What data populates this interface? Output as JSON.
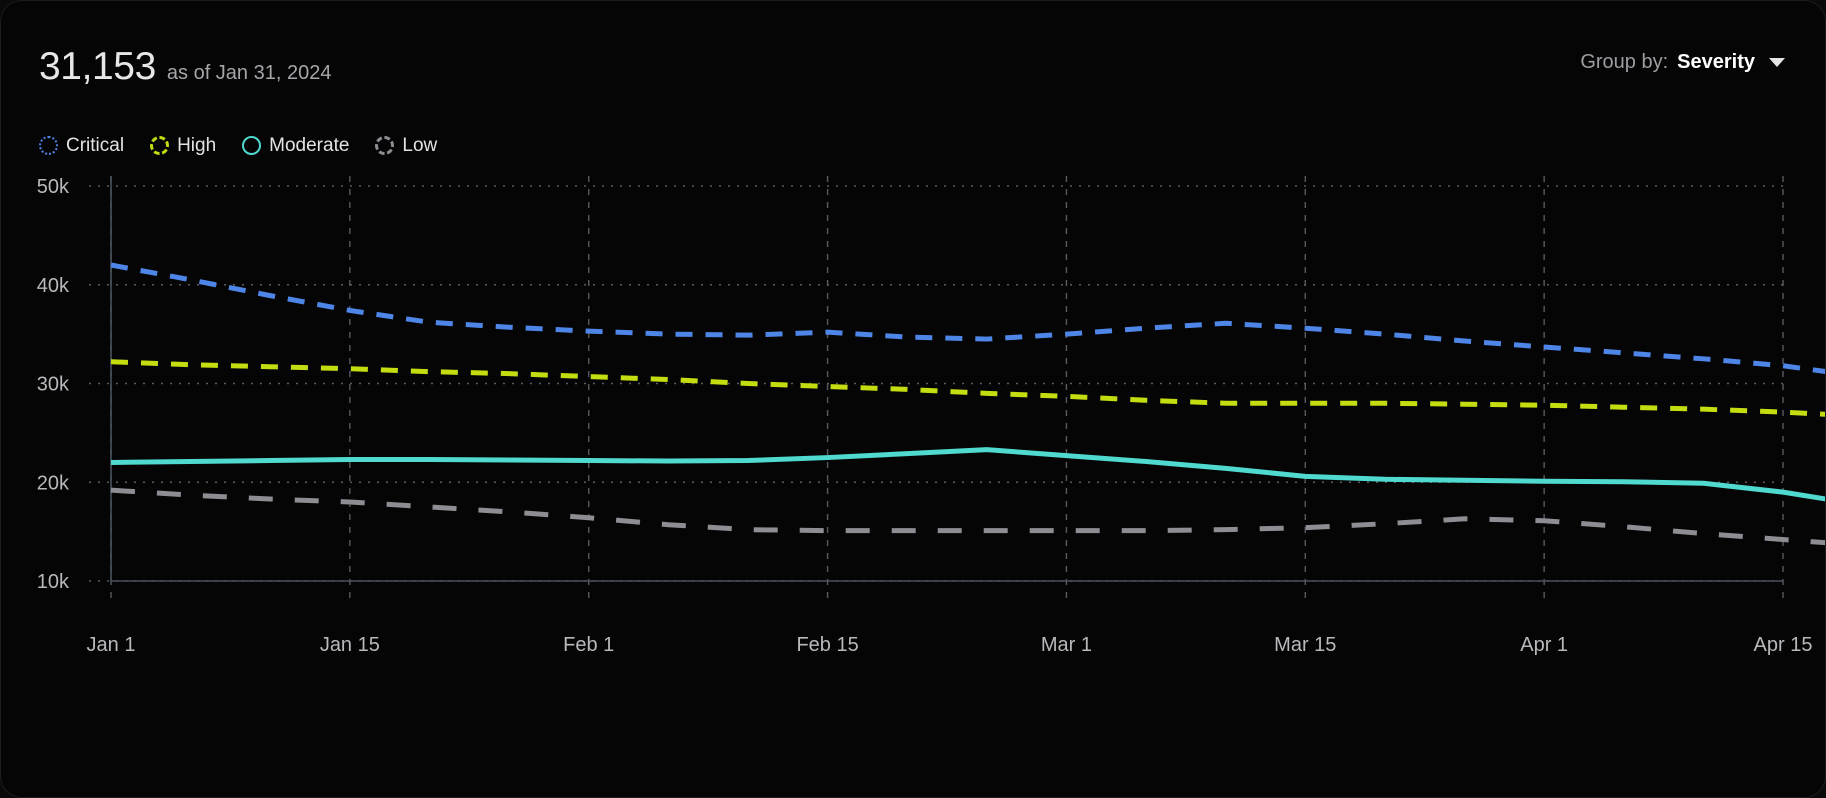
{
  "header": {
    "metric_value": "31,153",
    "as_of": "as of Jan 31, 2024",
    "group_by_label": "Group by:",
    "group_by_value": "Severity",
    "chevron_icon": "chevron-down-icon"
  },
  "legend": {
    "items": [
      {
        "label": "Critical",
        "color": "#4e86e8",
        "marker": "dotted-circle-icon"
      },
      {
        "label": "High",
        "color": "#c3dd10",
        "marker": "dashed-circle-icon"
      },
      {
        "label": "Moderate",
        "color": "#4fd9cf",
        "marker": "solid-circle-icon"
      },
      {
        "label": "Low",
        "color": "#8d8d93",
        "marker": "dashed-circle-icon"
      }
    ]
  },
  "chart_data": {
    "type": "line",
    "title": "",
    "subtitle": "",
    "xlabel": "",
    "ylabel": "",
    "grid": true,
    "legend_position": "top-left",
    "ylim": [
      10000,
      50000
    ],
    "ytick_labels": [
      "50k",
      "40k",
      "30k",
      "20k",
      "10k"
    ],
    "ytick_values": [
      50000,
      40000,
      30000,
      20000,
      10000
    ],
    "xtick_labels": [
      "Jan 1",
      "Jan 15",
      "Feb 1",
      "Feb 15",
      "Mar 1",
      "Mar 15",
      "Apr 1",
      "Apr 15"
    ],
    "x": [
      0,
      1,
      2,
      3,
      4,
      5,
      6,
      7,
      8,
      9,
      10,
      11,
      12,
      13,
      14,
      15,
      16,
      17,
      18,
      19,
      20,
      21
    ],
    "series": [
      {
        "name": "Critical",
        "color": "#4e86e8",
        "dash": "dashed",
        "values": [
          42000,
          40500,
          38900,
          37400,
          36200,
          35700,
          35300,
          35000,
          34900,
          35200,
          34700,
          34500,
          35000,
          35600,
          36100,
          35600,
          35000,
          34300,
          33700,
          33100,
          32500,
          31800,
          30700
        ]
      },
      {
        "name": "High",
        "color": "#c3dd10",
        "dash": "dashed",
        "values": [
          32200,
          31900,
          31700,
          31500,
          31200,
          31000,
          30700,
          30400,
          30000,
          29700,
          29400,
          29000,
          28700,
          28300,
          28000,
          28000,
          28000,
          27900,
          27800,
          27600,
          27400,
          27100,
          26700
        ]
      },
      {
        "name": "Moderate",
        "color": "#4fd9cf",
        "dash": "solid",
        "values": [
          22000,
          22100,
          22200,
          22300,
          22300,
          22250,
          22200,
          22150,
          22200,
          22500,
          22900,
          23300,
          22700,
          22100,
          21400,
          20600,
          20300,
          20200,
          20100,
          20050,
          19900,
          19000,
          17700
        ]
      },
      {
        "name": "Low",
        "color": "#8d8d93",
        "dash": "long-dashed",
        "values": [
          19200,
          18700,
          18300,
          18000,
          17500,
          17000,
          16400,
          15700,
          15200,
          15100,
          15100,
          15100,
          15100,
          15100,
          15200,
          15400,
          15800,
          16300,
          16100,
          15500,
          14800,
          14200,
          13600
        ]
      }
    ]
  }
}
